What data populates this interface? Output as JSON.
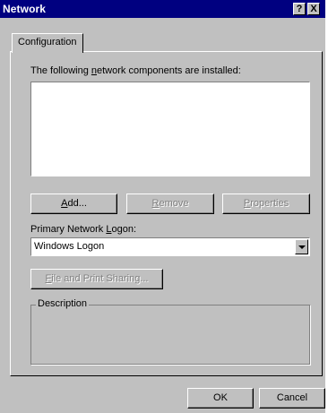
{
  "window": {
    "title": "Network",
    "help_label": "?",
    "close_label": "X"
  },
  "tabs": [
    {
      "label": "Configuration",
      "selected": true
    }
  ],
  "components": {
    "label_prefix": "The following ",
    "label_accel": "n",
    "label_suffix": "etwork components are installed:",
    "items": []
  },
  "buttons": {
    "add": {
      "accel": "A",
      "rest": "dd...",
      "enabled": true
    },
    "remove": {
      "accel": "R",
      "rest": "emove",
      "enabled": false
    },
    "properties": {
      "accel": "P",
      "rest": "roperties",
      "enabled": false
    },
    "file_print": {
      "accel": "F",
      "rest": "ile and Print Sharing...",
      "enabled": false
    }
  },
  "logon": {
    "label_prefix": "Primary Network ",
    "label_accel": "L",
    "label_suffix": "ogon:",
    "value": "Windows Logon"
  },
  "description": {
    "legend": "Description",
    "text": ""
  },
  "footer": {
    "ok_label": "OK",
    "cancel_label": "Cancel"
  },
  "colors": {
    "titlebar": "#000080",
    "face": "#c0c0c0",
    "disabled_text": "#808080"
  }
}
